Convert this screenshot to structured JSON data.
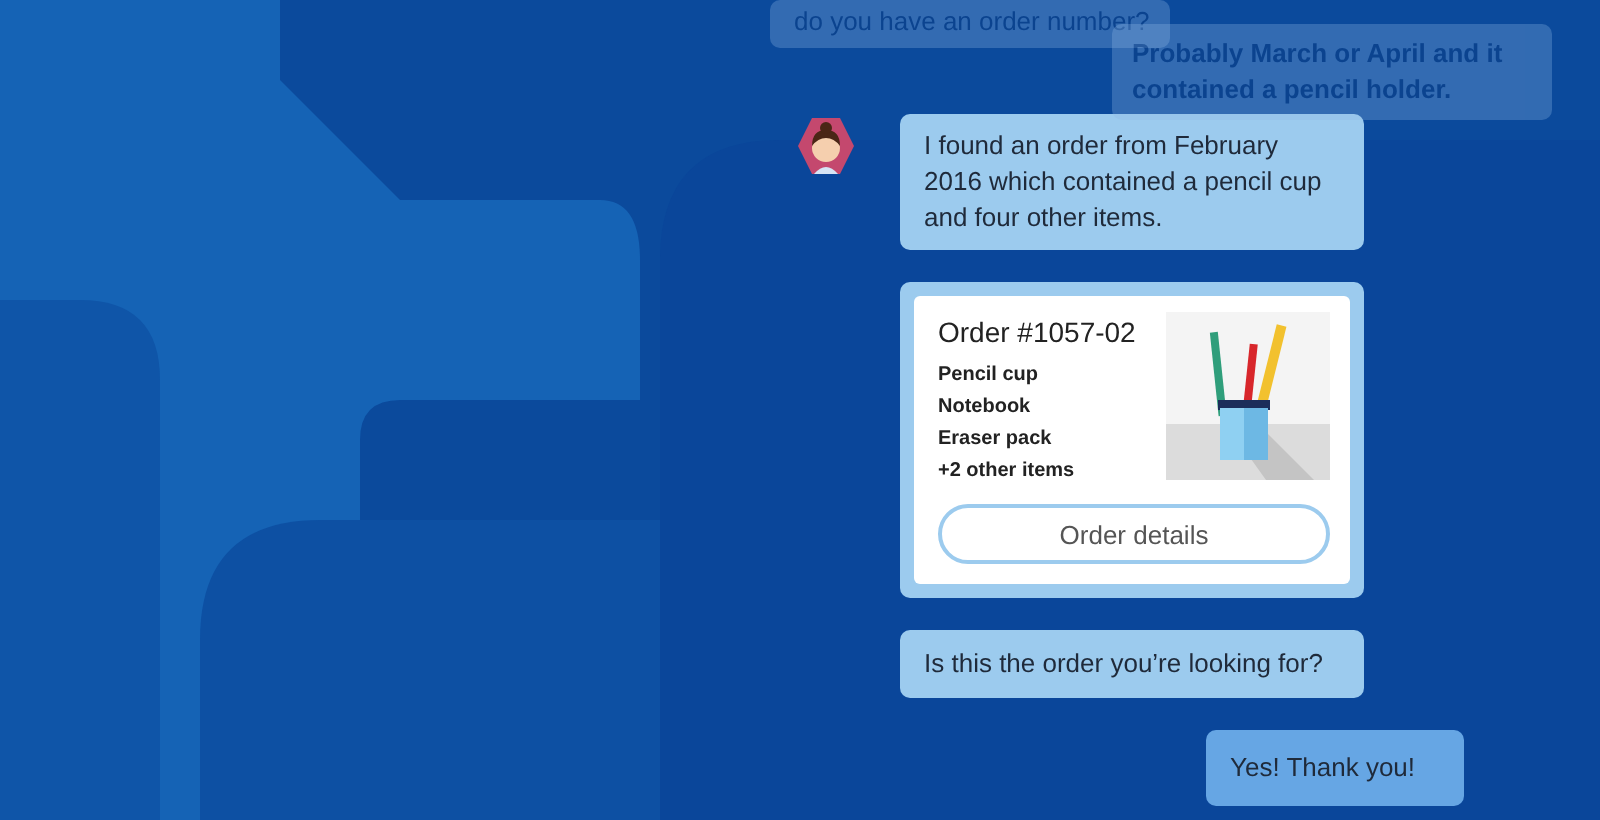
{
  "messages": [
    {
      "kind": "incoming",
      "faded": true,
      "text": "do you have an order number?"
    },
    {
      "kind": "outgoing",
      "faded": true,
      "text": "Probably March or April and it contained a pencil holder."
    },
    {
      "kind": "incoming",
      "faded": false,
      "avatar": true,
      "text": "I found an order from February 2016 which contained a pencil cup and four other items."
    },
    {
      "kind": "card",
      "faded": false,
      "title": "Order #1057-02",
      "items": [
        "Pencil cup",
        "Notebook",
        "Eraser pack",
        "+2 other items"
      ],
      "button": "Order details"
    },
    {
      "kind": "incoming",
      "faded": false,
      "text": "Is this the order you’re looking for?"
    },
    {
      "kind": "outgoing",
      "faded": false,
      "text": "Yes! Thank you!"
    }
  ]
}
